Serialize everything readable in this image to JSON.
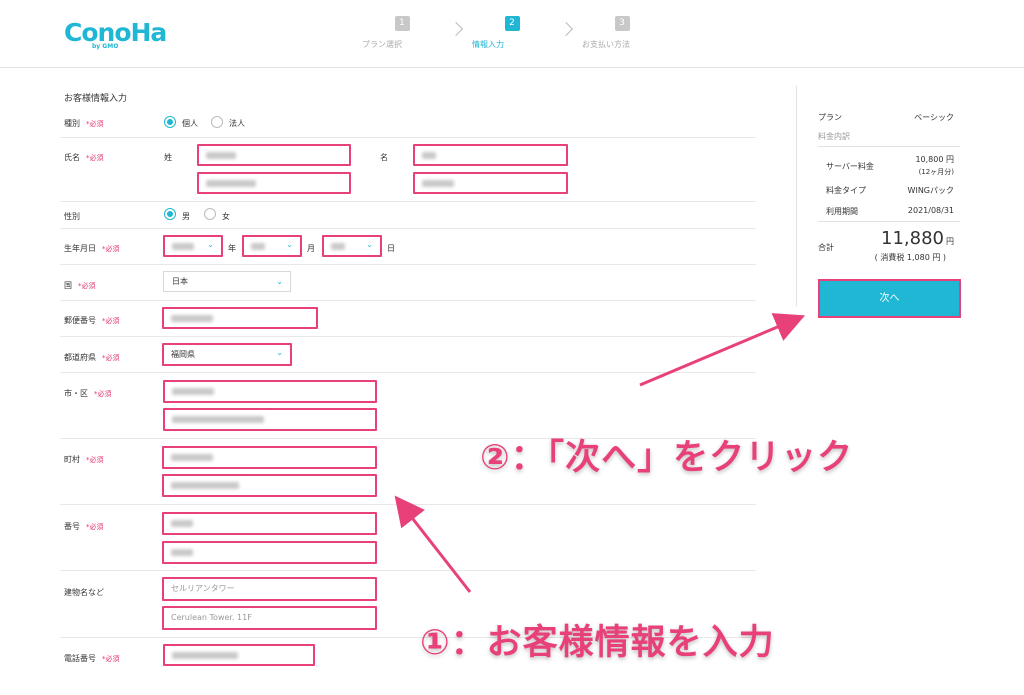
{
  "header": {
    "logo_text": "ConoHa",
    "logo_sub": "by GMO",
    "steps": [
      {
        "num": "1",
        "label": "プラン選択"
      },
      {
        "num": "2",
        "label": "情報入力"
      },
      {
        "num": "3",
        "label": "お支払い方法"
      }
    ]
  },
  "form": {
    "section_title": "お客様情報入力",
    "required_mark": "*必須",
    "type": {
      "label": "種別",
      "options": [
        "個人",
        "法人"
      ],
      "selected": "個人"
    },
    "name": {
      "label": "氏名",
      "last_label": "姓",
      "first_label": "名"
    },
    "gender": {
      "label": "性別",
      "options": [
        "男",
        "女"
      ],
      "selected": "男"
    },
    "birthday": {
      "label": "生年月日",
      "year_unit": "年",
      "month_unit": "月",
      "day_unit": "日"
    },
    "country": {
      "label": "国",
      "value": "日本"
    },
    "postal": {
      "label": "郵便番号"
    },
    "prefecture": {
      "label": "都道府県",
      "value": "福岡県"
    },
    "city": {
      "label": "市・区"
    },
    "town": {
      "label": "町村"
    },
    "number": {
      "label": "番号"
    },
    "building": {
      "label": "建物名など",
      "value_kana": "セルリアンタワー",
      "value_en": "Cerulean Tower. 11F"
    },
    "phone": {
      "label": "電話番号"
    }
  },
  "summary": {
    "plan_label": "プラン",
    "plan_value": "ベーシック",
    "breakdown_label": "料金内訳",
    "server_fee_label": "サーバー料金",
    "server_fee_value": "10,800 円",
    "server_fee_note": "(12ヶ月分)",
    "fee_type_label": "料金タイプ",
    "fee_type_value": "WINGパック",
    "period_label": "利用期間",
    "period_value": "2021/08/31",
    "total_label": "合計",
    "total_value": "11,880",
    "total_unit": "円",
    "tax_note": "( 消費税 1,080 円 )",
    "next_button": "次へ"
  },
  "annotations": {
    "step2": "②：「次へ」をクリック",
    "step1": "①：お客様情報を入力"
  },
  "colors": {
    "accent": "#1fb7d4",
    "highlight": "#e8417a"
  }
}
